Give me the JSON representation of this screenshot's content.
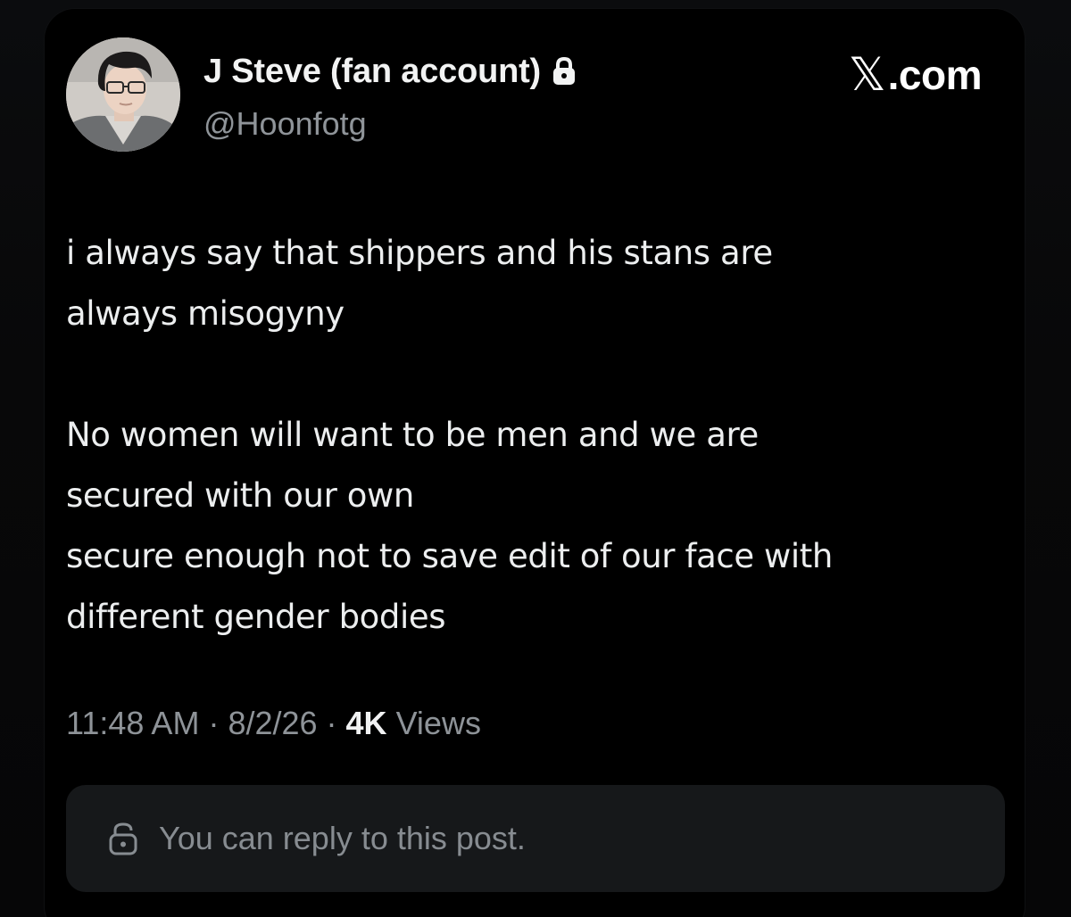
{
  "user": {
    "display_name": "J Steve (fan account)",
    "handle": "@Hoonfotg",
    "protected_icon": "lock-icon",
    "avatar": "profile photo"
  },
  "brand": {
    "x_mark": "𝕏",
    "suffix": ".com"
  },
  "post": {
    "lines": [
      "i always say that shippers and his stans are",
      "always misogyny",
      "",
      "No women will want to be men and we are",
      "secured with our own",
      "secure enough not to save edit of our face with",
      "different gender bodies"
    ]
  },
  "meta": {
    "time": "11:48 AM",
    "separator": "·",
    "date": "8/2/26",
    "views_count": "4K",
    "views_label": "Views"
  },
  "reply": {
    "icon": "unlock-icon",
    "text": "You can reply to this post."
  },
  "colors": {
    "background": "#000000",
    "text_primary": "#e7e9ea",
    "text_secondary": "#8e9398",
    "reply_box": "#16181a"
  }
}
